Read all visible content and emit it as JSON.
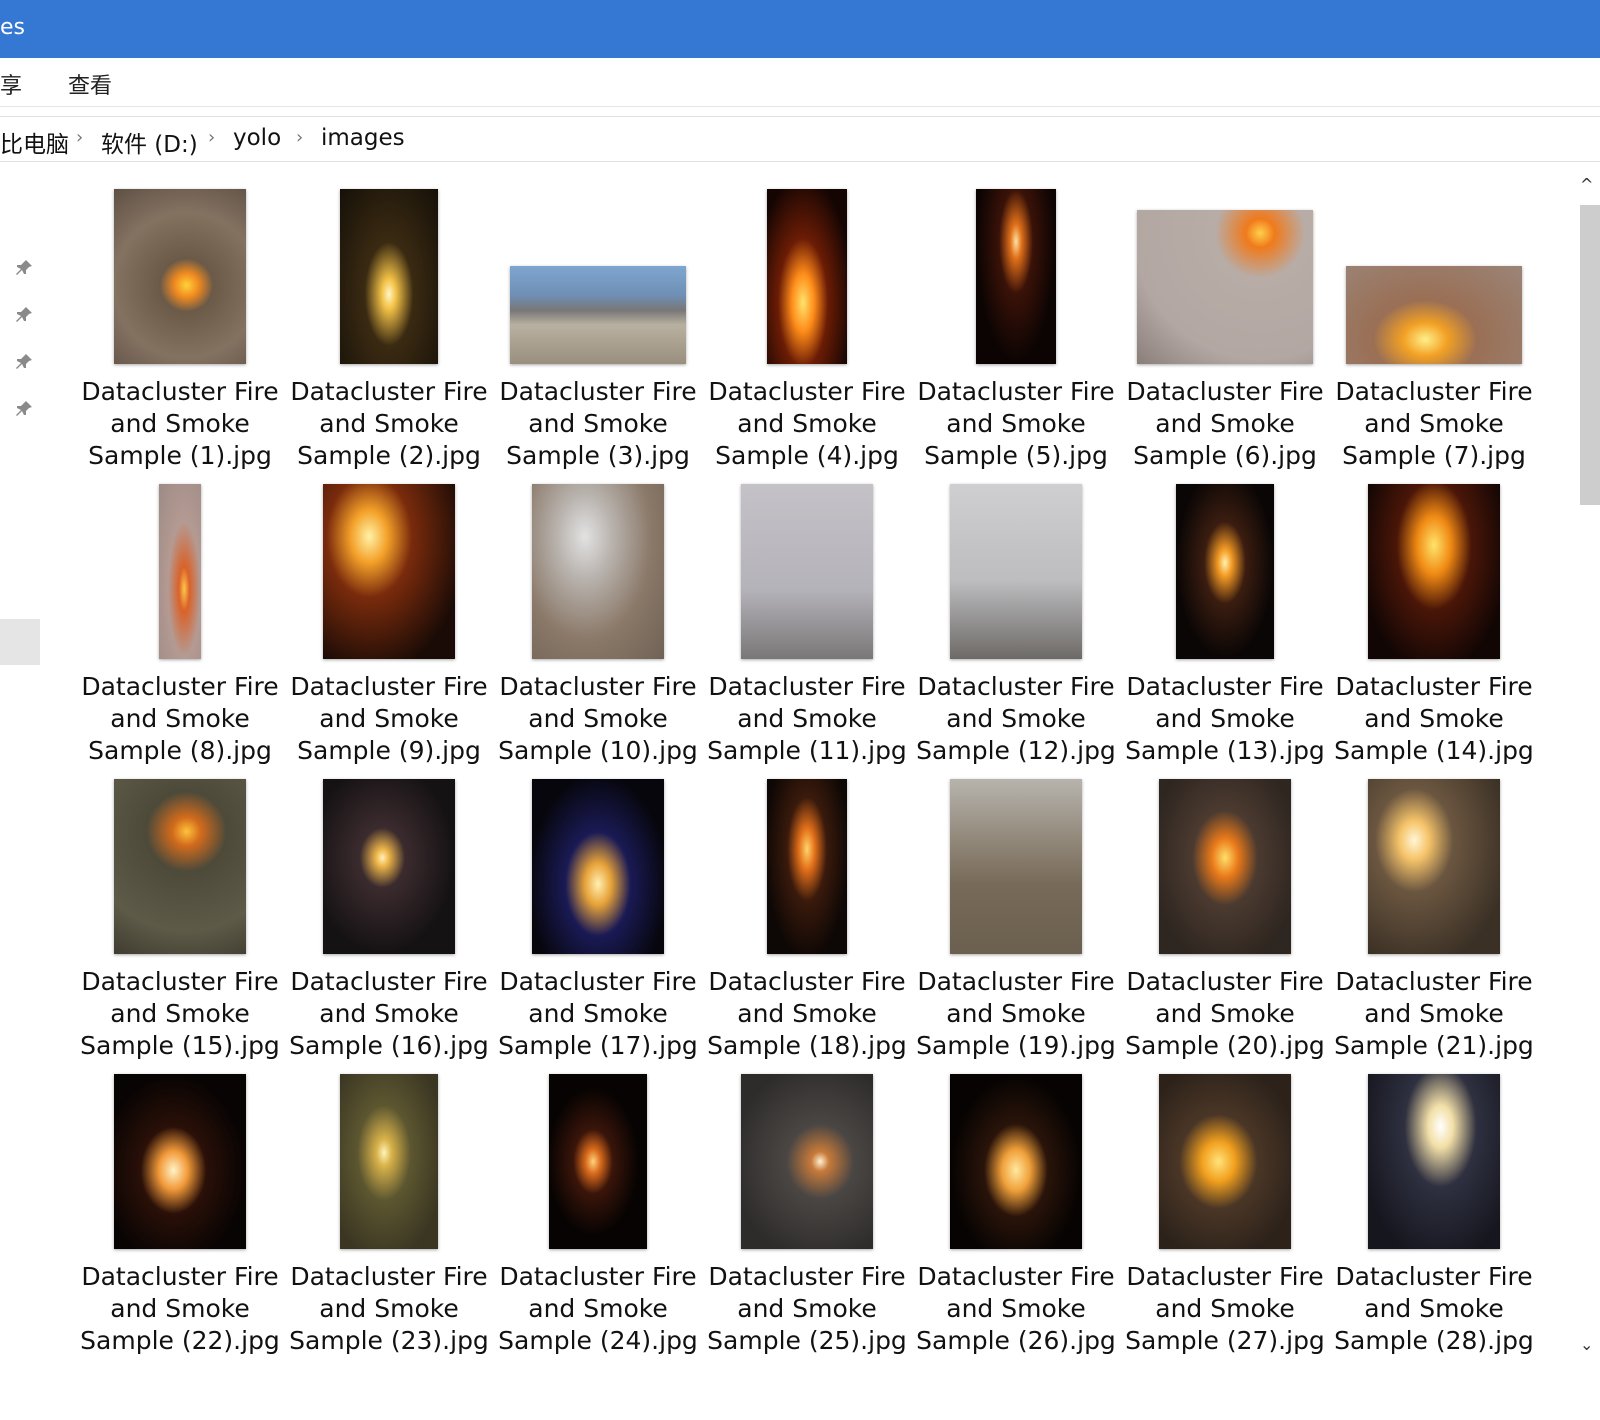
{
  "window": {
    "title_fragment": "es"
  },
  "ribbon": {
    "tab_share": "享",
    "tab_view": "查看"
  },
  "address": {
    "crumbs": [
      "比电脑",
      "软件 (D:)",
      "yolo",
      "images"
    ]
  },
  "files": [
    {
      "line1": "Datacluster Fire",
      "line2": "and Smoke",
      "line3": "Sample (1).jpg",
      "thumb": "ground-sticks-fire",
      "orientation": "portrait"
    },
    {
      "line1": "Datacluster Fire",
      "line2": "and Smoke",
      "line3": "Sample (2).jpg",
      "thumb": "dark-flame",
      "orientation": "portrait-narrow"
    },
    {
      "line1": "Datacluster Fire",
      "line2": "and Smoke",
      "line3": "Sample (3).jpg",
      "thumb": "city-smoke",
      "orientation": "landscape"
    },
    {
      "line1": "Datacluster Fire",
      "line2": "and Smoke",
      "line3": "Sample (4).jpg",
      "thumb": "night-bonfire",
      "orientation": "portrait-thin"
    },
    {
      "line1": "Datacluster Fire",
      "line2": "and Smoke",
      "line3": "Sample (5).jpg",
      "thumb": "night-glow",
      "orientation": "portrait-thin"
    },
    {
      "line1": "Datacluster Fire",
      "line2": "and Smoke",
      "line3": "Sample (6).jpg",
      "thumb": "street-fire",
      "orientation": "square-ish"
    },
    {
      "line1": "Datacluster Fire",
      "line2": "and Smoke",
      "line3": "Sample (7).jpg",
      "thumb": "ground-fire-wide",
      "orientation": "landscape"
    },
    {
      "line1": "Datacluster Fire",
      "line2": "and Smoke",
      "line3": "Sample (8).jpg",
      "thumb": "narrow-fire",
      "orientation": "very-narrow"
    },
    {
      "line1": "Datacluster Fire",
      "line2": "and Smoke",
      "line3": "Sample (9).jpg",
      "thumb": "building-fire",
      "orientation": "portrait"
    },
    {
      "line1": "Datacluster Fire",
      "line2": "and Smoke",
      "line3": "Sample (10).jpg",
      "thumb": "smoke-trash",
      "orientation": "portrait"
    },
    {
      "line1": "Datacluster Fire",
      "line2": "and Smoke",
      "line3": "Sample (11).jpg",
      "thumb": "tower",
      "orientation": "portrait"
    },
    {
      "line1": "Datacluster Fire",
      "line2": "and Smoke",
      "line3": "Sample (12).jpg",
      "thumb": "tower-2",
      "orientation": "portrait"
    },
    {
      "line1": "Datacluster Fire",
      "line2": "and Smoke",
      "line3": "Sample (13).jpg",
      "thumb": "night-flame",
      "orientation": "portrait-narrow"
    },
    {
      "line1": "Datacluster Fire",
      "line2": "and Smoke",
      "line3": "Sample (14).jpg",
      "thumb": "night-big-flame",
      "orientation": "portrait"
    },
    {
      "line1": "Datacluster Fire",
      "line2": "and Smoke",
      "line3": "Sample (15).jpg",
      "thumb": "grass-fire",
      "orientation": "portrait"
    },
    {
      "line1": "Datacluster Fire",
      "line2": "and Smoke",
      "line3": "Sample (16).jpg",
      "thumb": "dark-small-flame",
      "orientation": "portrait"
    },
    {
      "line1": "Datacluster Fire",
      "line2": "and Smoke",
      "line3": "Sample (17).jpg",
      "thumb": "blue-flame",
      "orientation": "portrait"
    },
    {
      "line1": "Datacluster Fire",
      "line2": "and Smoke",
      "line3": "Sample (18).jpg",
      "thumb": "night-sticks-fire",
      "orientation": "portrait-thin"
    },
    {
      "line1": "Datacluster Fire",
      "line2": "and Smoke",
      "line3": "Sample (19).jpg",
      "thumb": "yard-fire",
      "orientation": "portrait"
    },
    {
      "line1": "Datacluster Fire",
      "line2": "and Smoke",
      "line3": "Sample (20).jpg",
      "thumb": "pipe-fire",
      "orientation": "portrait"
    },
    {
      "line1": "Datacluster Fire",
      "line2": "and Smoke",
      "line3": "Sample (21).jpg",
      "thumb": "rock-fire",
      "orientation": "portrait"
    },
    {
      "line1": "Datacluster Fire",
      "line2": "and Smoke",
      "line3": "Sample (22).jpg",
      "thumb": "night-flame-2",
      "orientation": "portrait"
    },
    {
      "line1": "Datacluster Fire",
      "line2": "and Smoke",
      "line3": "Sample (23).jpg",
      "thumb": "glow-ground",
      "orientation": "portrait-narrow"
    },
    {
      "line1": "Datacluster Fire",
      "line2": "and Smoke",
      "line3": "Sample (24).jpg",
      "thumb": "ember-dark",
      "orientation": "portrait-narrow"
    },
    {
      "line1": "Datacluster Fire",
      "line2": "and Smoke",
      "line3": "Sample (25).jpg",
      "thumb": "dim-fire",
      "orientation": "portrait"
    },
    {
      "line1": "Datacluster Fire",
      "line2": "and Smoke",
      "line3": "Sample (26).jpg",
      "thumb": "night-splash-fire",
      "orientation": "portrait"
    },
    {
      "line1": "Datacluster Fire",
      "line2": "and Smoke",
      "line3": "Sample (27).jpg",
      "thumb": "trash-fire",
      "orientation": "portrait"
    },
    {
      "line1": "Datacluster Fire",
      "line2": "and Smoke",
      "line3": "Sample (28).jpg",
      "thumb": "bright-torch",
      "orientation": "portrait"
    }
  ],
  "colors": {
    "titlebar": "#3478d4"
  }
}
